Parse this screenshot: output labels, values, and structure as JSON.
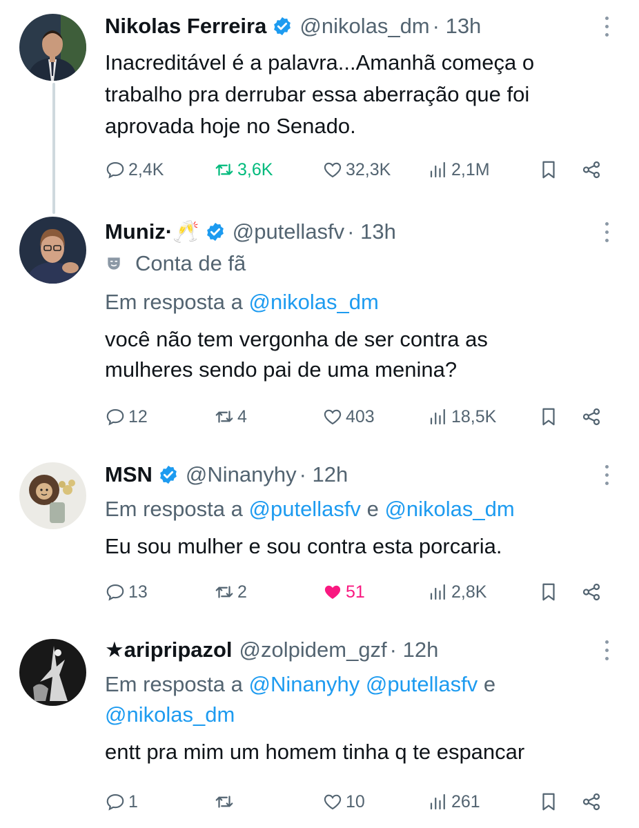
{
  "tweets": [
    {
      "name": "Nikolas Ferreira",
      "handle": "@nikolas_dm",
      "time": "· 13h",
      "text": "Inacreditável é a palavra...Amanhã começa o\ntrabalho pra derrubar essa aberração que foi\naprovada hoje no Senado.",
      "replies": "2,4K",
      "retweets": "3,6K",
      "likes": "32,3K",
      "views": "2,1M"
    },
    {
      "name": "Muniz·🥂",
      "handle": "@putellasfv",
      "time": "· 13h",
      "fan_label": "Conta de fã",
      "reply_prefix": "Em resposta a",
      "reply_mentions": [
        "@nikolas_dm"
      ],
      "text": "você não tem vergonha de ser contra as\nmulheres sendo pai de uma menina?",
      "replies": "12",
      "retweets": "4",
      "likes": "403",
      "views": "18,5K"
    },
    {
      "name": "MSN",
      "handle": "@Ninanyhy",
      "time": "· 12h",
      "reply_prefix": "Em resposta a",
      "reply_mentions": [
        "@putellasfv",
        "@nikolas_dm"
      ],
      "reply_joiner": "e",
      "text": "Eu sou mulher e sou contra esta porcaria.",
      "replies": "13",
      "retweets": "2",
      "likes": "51",
      "views": "2,8K"
    },
    {
      "name": "★aripripazol",
      "handle": "@zolpidem_gzf",
      "time": "· 12h",
      "reply_prefix": "Em resposta a",
      "reply_mentions": [
        "@Ninanyhy",
        "@putellasfv",
        "@nikolas_dm"
      ],
      "reply_joiner": "e",
      "text": "entt pra mim um homem tinha q te espancar",
      "replies": "1",
      "retweets": "",
      "likes": "10",
      "views": "261"
    }
  ],
  "colors": {
    "accent": "#1d9bf0",
    "retweeted": "#00ba7c",
    "liked": "#f91880",
    "secondary": "#536471"
  }
}
